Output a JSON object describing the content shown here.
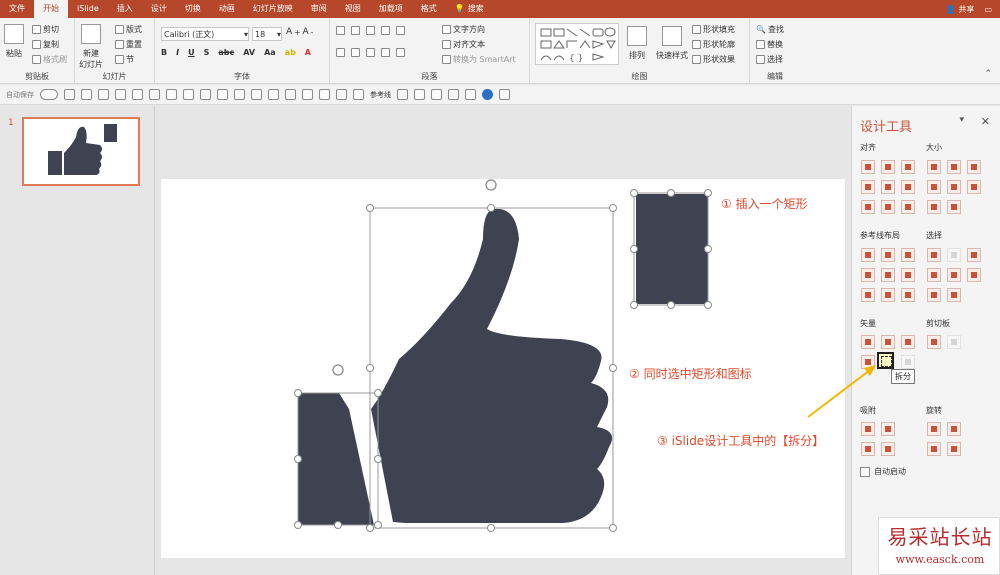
{
  "tabs": [
    "文件",
    "开始",
    "iSlide",
    "插入",
    "设计",
    "切换",
    "动画",
    "幻灯片放映",
    "审阅",
    "视图",
    "加载项",
    "格式"
  ],
  "search_label": "搜索",
  "share_label": "共享",
  "ribbon": {
    "paste": "粘贴",
    "cut": "剪切",
    "copy": "复制",
    "format_painter": "格式刷",
    "clipboard_label": "剪贴板",
    "new_slide": "新建\n幻灯片",
    "layout": "版式",
    "reset": "重置",
    "section": "节",
    "slides_label": "幻灯片",
    "font_name": "Calibri (正文)",
    "font_size": "18",
    "font_label": "字体",
    "text_direction": "文字方向",
    "align_text": "对齐文本",
    "smartart": "转换为 SmartArt",
    "paragraph_label": "段落",
    "arrange": "排列",
    "quick_styles": "快速样式",
    "shape_fill": "形状填充",
    "shape_outline": "形状轮廓",
    "shape_effects": "形状效果",
    "drawing_label": "绘图",
    "find": "查找",
    "replace": "替换",
    "select": "选择",
    "editing_label": "编辑"
  },
  "qat": {
    "autosave": "自动保存",
    "guides": "参考线"
  },
  "slide_number": "1",
  "panel": {
    "title": "设计工具",
    "align": "对齐",
    "size": "大小",
    "guide_layout": "参考线布局",
    "select": "选择",
    "vector": "矢量",
    "clipboard": "剪切板",
    "snap": "吸附",
    "rotate": "旋转",
    "split_tooltip": "拆分",
    "auto_start": "自动启动"
  },
  "annotations": {
    "a1": "① 插入一个矩形",
    "a2": "② 同时选中矩形和图标",
    "a3": "③ iSlide设计工具中的【拆分】"
  },
  "watermark": {
    "cn": "易采站长站",
    "url": "www.easck.com"
  },
  "colors": {
    "accent": "#b7472a",
    "shape": "#3f4251",
    "annotation": "#e0482a",
    "arrow": "#f5b700"
  }
}
